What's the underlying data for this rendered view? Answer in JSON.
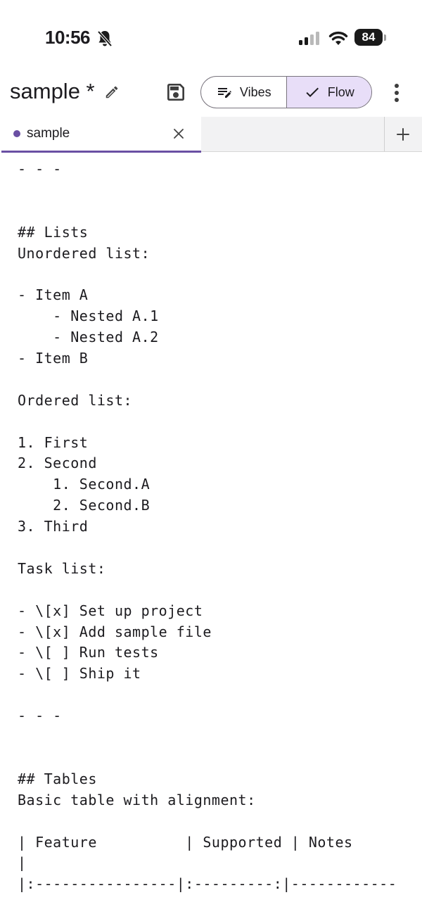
{
  "status_bar": {
    "time": "10:56",
    "battery": "84"
  },
  "app_bar": {
    "title": "sample *",
    "vibes_label": "Vibes",
    "flow_label": "Flow"
  },
  "tabs": [
    {
      "label": "sample"
    }
  ],
  "editor": {
    "lines": [
      "- - -",
      "",
      "",
      "## Lists",
      "Unordered list:",
      "",
      "- Item A",
      "    - Nested A.1",
      "    - Nested A.2",
      "- Item B",
      "",
      "Ordered list:",
      "",
      "1. First",
      "2. Second",
      "    1. Second.A",
      "    2. Second.B",
      "3. Third",
      "",
      "Task list:",
      "",
      "- \\[x] Set up project",
      "- \\[x] Add sample file",
      "- \\[ ] Run tests",
      "- \\[ ] Ship it",
      "",
      "- - -",
      "",
      "",
      "## Tables",
      "Basic table with alignment:",
      "",
      "| Feature          | Supported | Notes",
      "|",
      "|:----------------|:---------:|------------"
    ]
  },
  "colors": {
    "accent": "#6a4fa3",
    "flow_selected_bg": "#e8def8",
    "tab_strip_bg": "#f2f2f3"
  },
  "icons": {
    "status": [
      "bell-off-icon",
      "signal-icon",
      "wifi-icon",
      "battery-icon"
    ],
    "app_bar": [
      "pencil-icon",
      "save-icon",
      "vibes-edit-icon",
      "checkmark-icon",
      "more-vert-icon"
    ],
    "tabs": [
      "unsaved-dot-icon",
      "close-icon",
      "plus-icon"
    ]
  }
}
